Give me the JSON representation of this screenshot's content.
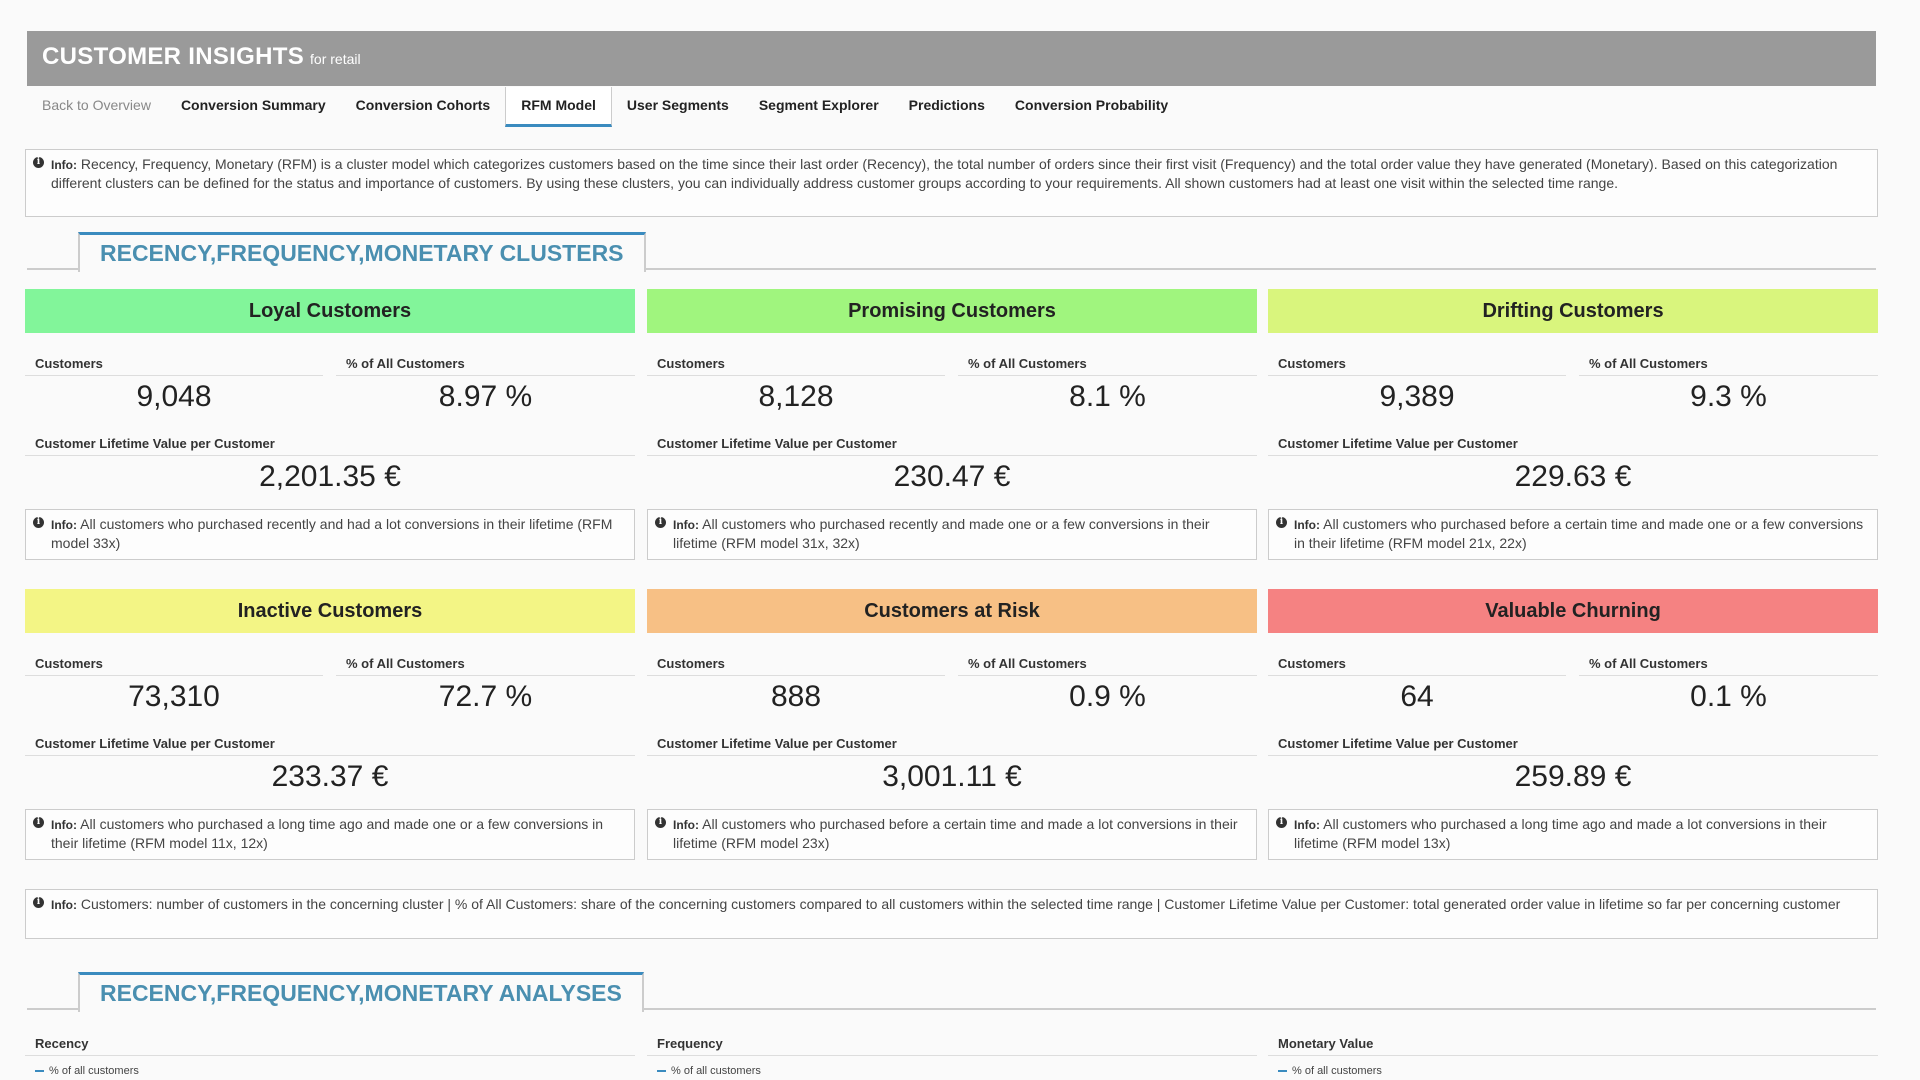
{
  "app": {
    "title": "CUSTOMER INSIGHTS",
    "subtitle": "for retail"
  },
  "tabs": [
    {
      "label": "Back to Overview"
    },
    {
      "label": "Conversion Summary"
    },
    {
      "label": "Conversion Cohorts"
    },
    {
      "label": "RFM Model"
    },
    {
      "label": "User Segments"
    },
    {
      "label": "Segment Explorer"
    },
    {
      "label": "Predictions"
    },
    {
      "label": "Conversion Probability"
    }
  ],
  "info_label": "Info:",
  "top_info": "Recency, Frequency, Monetary (RFM) is a cluster model which categorizes customers based on the time since their last order (Recency), the total number of orders since their first visit (Frequency) and the total order value they have generated (Monetary). Based on this categorization different clusters can be defined for the status and importance of customers. By using these clusters, you can individually address customer groups according to your requirements. All shown customers had at least one visit within the selected time range.",
  "section_clusters": "RECENCY,FREQUENCY,MONETARY CLUSTERS",
  "labels": {
    "customers": "Customers",
    "pct": "% of All Customers",
    "clv": "Customer Lifetime Value per Customer"
  },
  "colors": {
    "loyal": "#82f59a",
    "promising": "#a0f57e",
    "drifting": "#d9f57d",
    "inactive": "#f3f585",
    "risk": "#f7c085",
    "churning": "#f58282",
    "accent": "#3a8bbf"
  },
  "clusters": [
    {
      "name": "Loyal Customers",
      "customers": "9,048",
      "pct": "8.97 %",
      "clv": "2,201.35 €",
      "info": "All customers who purchased recently and had a lot conversions in their lifetime (RFM model 33x)"
    },
    {
      "name": "Promising Customers",
      "customers": "8,128",
      "pct": "8.1 %",
      "clv": "230.47 €",
      "info": "All customers who purchased recently and made one or a few conversions in their lifetime (RFM model 31x, 32x)"
    },
    {
      "name": "Drifting Customers",
      "customers": "9,389",
      "pct": "9.3 %",
      "clv": "229.63 €",
      "info": "All customers who purchased before a certain time and made one or a few conversions in their lifetime (RFM model 21x, 22x)"
    },
    {
      "name": "Inactive Customers",
      "customers": "73,310",
      "pct": "72.7 %",
      "clv": "233.37 €",
      "info": "All customers who purchased a long time ago and made one or a few conversions in their lifetime (RFM model 11x, 12x)"
    },
    {
      "name": "Customers at Risk",
      "customers": "888",
      "pct": "0.9 %",
      "clv": "3,001.11 €",
      "info": "All customers who purchased before a certain time and made a lot conversions in their lifetime (RFM model 23x)"
    },
    {
      "name": "Valuable Churning",
      "customers": "64",
      "pct": "0.1 %",
      "clv": "259.89 €",
      "info": "All customers who purchased a long time ago and made a lot conversions in their lifetime (RFM model 13x)"
    }
  ],
  "bottom_info": "Customers: number of customers in the concerning cluster | % of All Customers: share of the concerning customers compared to all customers within the selected time range | Customer Lifetime Value per Customer: total generated order value in lifetime so far per concerning customer",
  "section_analyses": "RECENCY,FREQUENCY,MONETARY ANALYSES",
  "analyses": [
    {
      "label": "Recency",
      "legend": "% of all customers"
    },
    {
      "label": "Frequency",
      "legend": "% of all customers"
    },
    {
      "label": "Monetary Value",
      "legend": "% of all customers"
    }
  ]
}
